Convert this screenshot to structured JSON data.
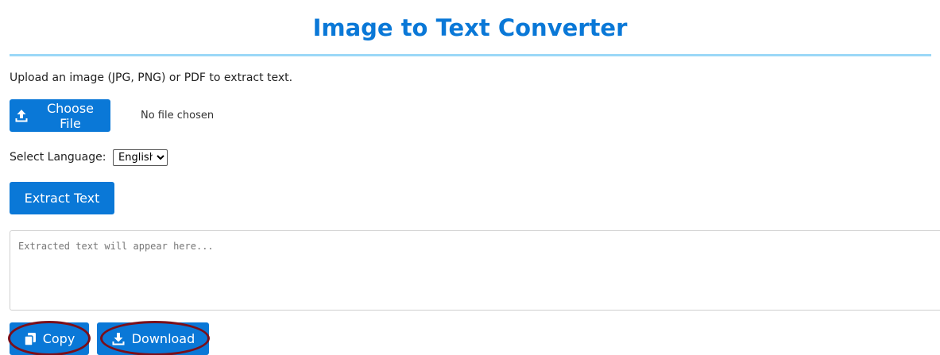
{
  "header": {
    "title": "Image to Text Converter"
  },
  "upload": {
    "instructions": "Upload an image (JPG, PNG) or PDF to extract text.",
    "choose_label": "Choose File",
    "file_status": "No file chosen"
  },
  "language": {
    "label": "Select Language:",
    "selected": "English"
  },
  "actions": {
    "extract_label": "Extract Text",
    "copy_label": "Copy",
    "download_label": "Download"
  },
  "result": {
    "placeholder": "Extracted text will appear here...",
    "value": ""
  },
  "colors": {
    "accent": "#0a78d7",
    "title_rule": "#9bd8f7",
    "annotation_ring": "#7a0f1a"
  },
  "icons": {
    "choose": "upload-icon",
    "copy": "copy-icon",
    "download": "download-icon"
  }
}
